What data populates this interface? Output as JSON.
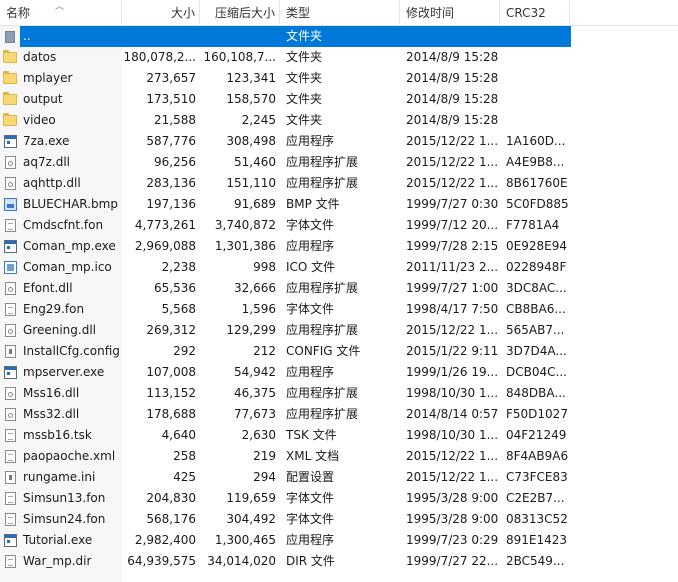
{
  "columns": {
    "name": "名称",
    "size": "大小",
    "compressed": "压缩后大小",
    "type": "类型",
    "modified": "修改时间",
    "crc": "CRC32"
  },
  "files": [
    {
      "name": "..",
      "size": "",
      "compressed": "",
      "type": "文件夹",
      "modified": "",
      "crc": "",
      "icon": "up-folder-icon",
      "selected": true
    },
    {
      "name": "datos",
      "size": "180,078,2...",
      "compressed": "160,108,7...",
      "type": "文件夹",
      "modified": "2014/8/9 15:28",
      "crc": "",
      "icon": "folder-icon"
    },
    {
      "name": "mplayer",
      "size": "273,657",
      "compressed": "123,341",
      "type": "文件夹",
      "modified": "2014/8/9 15:28",
      "crc": "",
      "icon": "folder-icon"
    },
    {
      "name": "output",
      "size": "173,510",
      "compressed": "158,570",
      "type": "文件夹",
      "modified": "2014/8/9 15:28",
      "crc": "",
      "icon": "folder-icon"
    },
    {
      "name": "video",
      "size": "21,588",
      "compressed": "2,245",
      "type": "文件夹",
      "modified": "2014/8/9 15:28",
      "crc": "",
      "icon": "folder-icon"
    },
    {
      "name": "7za.exe",
      "size": "587,776",
      "compressed": "308,498",
      "type": "应用程序",
      "modified": "2015/12/22 1...",
      "crc": "1A160D...",
      "icon": "exe-icon"
    },
    {
      "name": "aq7z.dll",
      "size": "96,256",
      "compressed": "51,460",
      "type": "应用程序扩展",
      "modified": "2015/12/22 1...",
      "crc": "A4E9B8...",
      "icon": "dll-icon"
    },
    {
      "name": "aqhttp.dll",
      "size": "283,136",
      "compressed": "151,110",
      "type": "应用程序扩展",
      "modified": "2015/12/22 1...",
      "crc": "8B61760E",
      "icon": "dll-icon"
    },
    {
      "name": "BLUECHAR.bmp",
      "size": "197,136",
      "compressed": "91,689",
      "type": "BMP 文件",
      "modified": "1999/7/27 0:30",
      "crc": "5C0FD885",
      "icon": "bmp-icon"
    },
    {
      "name": "Cmdscfnt.fon",
      "size": "4,773,261",
      "compressed": "3,740,872",
      "type": "字体文件",
      "modified": "1999/7/12 20...",
      "crc": "F7781A4",
      "icon": "font-file-icon"
    },
    {
      "name": "Coman_mp.exe",
      "size": "2,969,088",
      "compressed": "1,301,386",
      "type": "应用程序",
      "modified": "1999/7/28 2:15",
      "crc": "0E928E94",
      "icon": "exe-icon"
    },
    {
      "name": "Coman_mp.ico",
      "size": "2,238",
      "compressed": "998",
      "type": "ICO 文件",
      "modified": "2011/11/23 2...",
      "crc": "0228948F",
      "icon": "ico-file-icon"
    },
    {
      "name": "Efont.dll",
      "size": "65,536",
      "compressed": "32,666",
      "type": "应用程序扩展",
      "modified": "1999/7/27 1:00",
      "crc": "3DC8AC...",
      "icon": "dll-icon"
    },
    {
      "name": "Eng29.fon",
      "size": "5,568",
      "compressed": "1,596",
      "type": "字体文件",
      "modified": "1998/4/17 7:50",
      "crc": "CB8BA6...",
      "icon": "font-file-icon"
    },
    {
      "name": "Greening.dll",
      "size": "269,312",
      "compressed": "129,299",
      "type": "应用程序扩展",
      "modified": "2015/12/22 1...",
      "crc": "565AB7...",
      "icon": "dll-icon"
    },
    {
      "name": "InstallCfg.config",
      "size": "292",
      "compressed": "212",
      "type": "CONFIG 文件",
      "modified": "2015/1/22 9:11",
      "crc": "3D7D4A...",
      "icon": "config-file-icon"
    },
    {
      "name": "mpserver.exe",
      "size": "107,008",
      "compressed": "54,942",
      "type": "应用程序",
      "modified": "1999/1/26 19...",
      "crc": "DCB04C...",
      "icon": "exe-icon"
    },
    {
      "name": "Mss16.dll",
      "size": "113,152",
      "compressed": "46,375",
      "type": "应用程序扩展",
      "modified": "1998/10/30 1...",
      "crc": "848DBA...",
      "icon": "dll-icon"
    },
    {
      "name": "Mss32.dll",
      "size": "178,688",
      "compressed": "77,673",
      "type": "应用程序扩展",
      "modified": "2014/8/14 0:57",
      "crc": "F50D1027",
      "icon": "dll-icon"
    },
    {
      "name": "mssb16.tsk",
      "size": "4,640",
      "compressed": "2,630",
      "type": "TSK 文件",
      "modified": "1998/10/30 1...",
      "crc": "04F21249",
      "icon": "file-icon"
    },
    {
      "name": "paopaoche.xml",
      "size": "258",
      "compressed": "219",
      "type": "XML 文档",
      "modified": "2015/12/22 1...",
      "crc": "8F4AB9A6",
      "icon": "xml-file-icon"
    },
    {
      "name": "rungame.ini",
      "size": "425",
      "compressed": "294",
      "type": "配置设置",
      "modified": "2015/12/22 1...",
      "crc": "C73FCE83",
      "icon": "config-file-icon"
    },
    {
      "name": "Simsun13.fon",
      "size": "204,830",
      "compressed": "119,659",
      "type": "字体文件",
      "modified": "1995/3/28 9:00",
      "crc": "C2E2B7...",
      "icon": "font-file-icon"
    },
    {
      "name": "Simsun24.fon",
      "size": "568,176",
      "compressed": "304,492",
      "type": "字体文件",
      "modified": "1995/3/28 9:00",
      "crc": "08313C52",
      "icon": "font-file-icon"
    },
    {
      "name": "Tutorial.exe",
      "size": "2,982,400",
      "compressed": "1,300,465",
      "type": "应用程序",
      "modified": "1999/7/23 0:29",
      "crc": "891E1423",
      "icon": "exe-icon"
    },
    {
      "name": "War_mp.dir",
      "size": "64,939,575",
      "compressed": "34,014,020",
      "type": "DIR 文件",
      "modified": "1999/7/27 22...",
      "crc": "2BC549...",
      "icon": "file-icon"
    }
  ]
}
